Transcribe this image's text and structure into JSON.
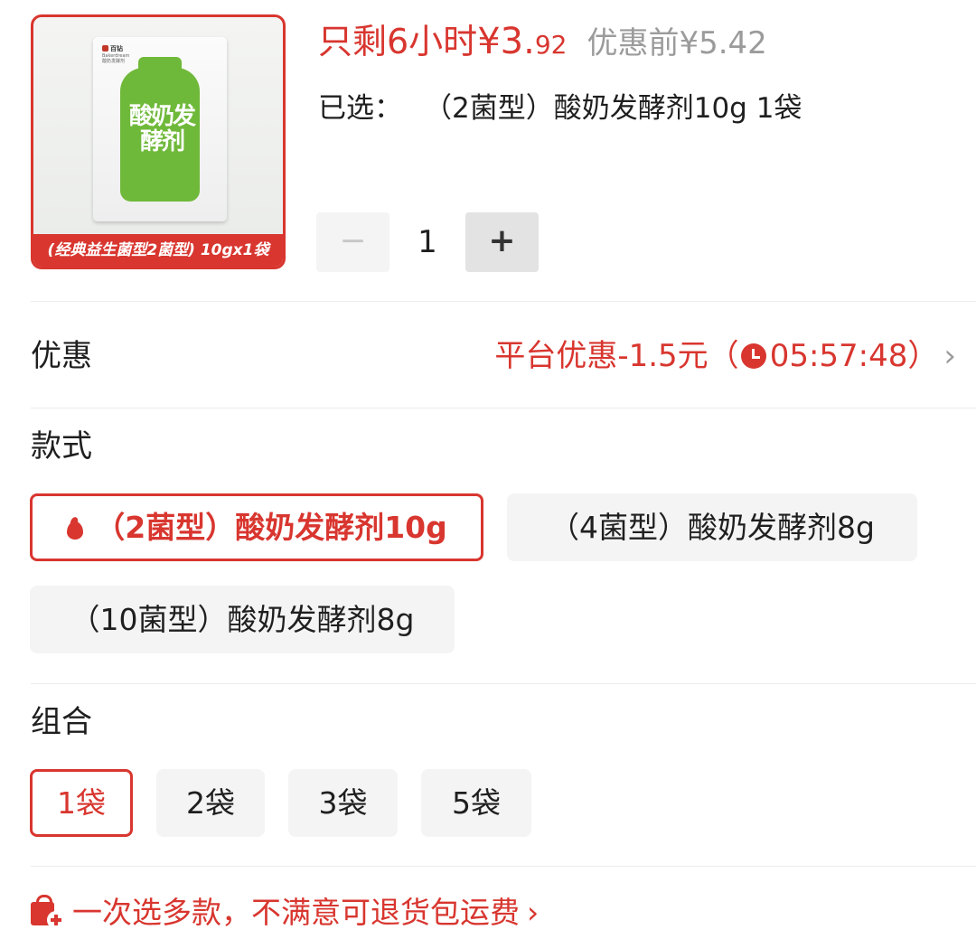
{
  "product": {
    "image_banner": "(经典益生菌型2菌型) 10gx1袋",
    "pouch_brand": "百钻",
    "pouch_brand_en": "Bakerdream",
    "pouch_subtitle": "酸奶发酵剂",
    "pouch_art_text": "酸奶发酵剂",
    "price_label": "只剩6小时",
    "price_currency": "¥",
    "price_int": "3.",
    "price_dec": "92",
    "price_before": "优惠前¥5.42",
    "selected_label": "已选：",
    "selected_value": "（2菌型）酸奶发酵剂10g 1袋"
  },
  "stepper": {
    "minus": "−",
    "quantity": "1",
    "plus": "+"
  },
  "promo": {
    "label": "优惠",
    "text": "平台优惠-1.5元（",
    "countdown": "05:57:48",
    "close_paren": "）",
    "chevron": "›"
  },
  "style_section": {
    "label": "款式",
    "options": [
      {
        "label": "（2菌型）酸奶发酵剂10g",
        "selected": true,
        "hot": true
      },
      {
        "label": "（4菌型）酸奶发酵剂8g",
        "selected": false
      },
      {
        "label": "（10菌型）酸奶发酵剂8g",
        "selected": false
      }
    ]
  },
  "combo_section": {
    "label": "组合",
    "options": [
      {
        "label": "1袋",
        "selected": true
      },
      {
        "label": "2袋",
        "selected": false
      },
      {
        "label": "3袋",
        "selected": false
      },
      {
        "label": "5袋",
        "selected": false
      }
    ]
  },
  "footer": {
    "text": "一次选多款，不满意可退货包运费",
    "chevron": "›"
  },
  "colors": {
    "accent": "#d8362f",
    "muted": "#9b9b9b",
    "chip_bg": "#f4f4f4"
  }
}
